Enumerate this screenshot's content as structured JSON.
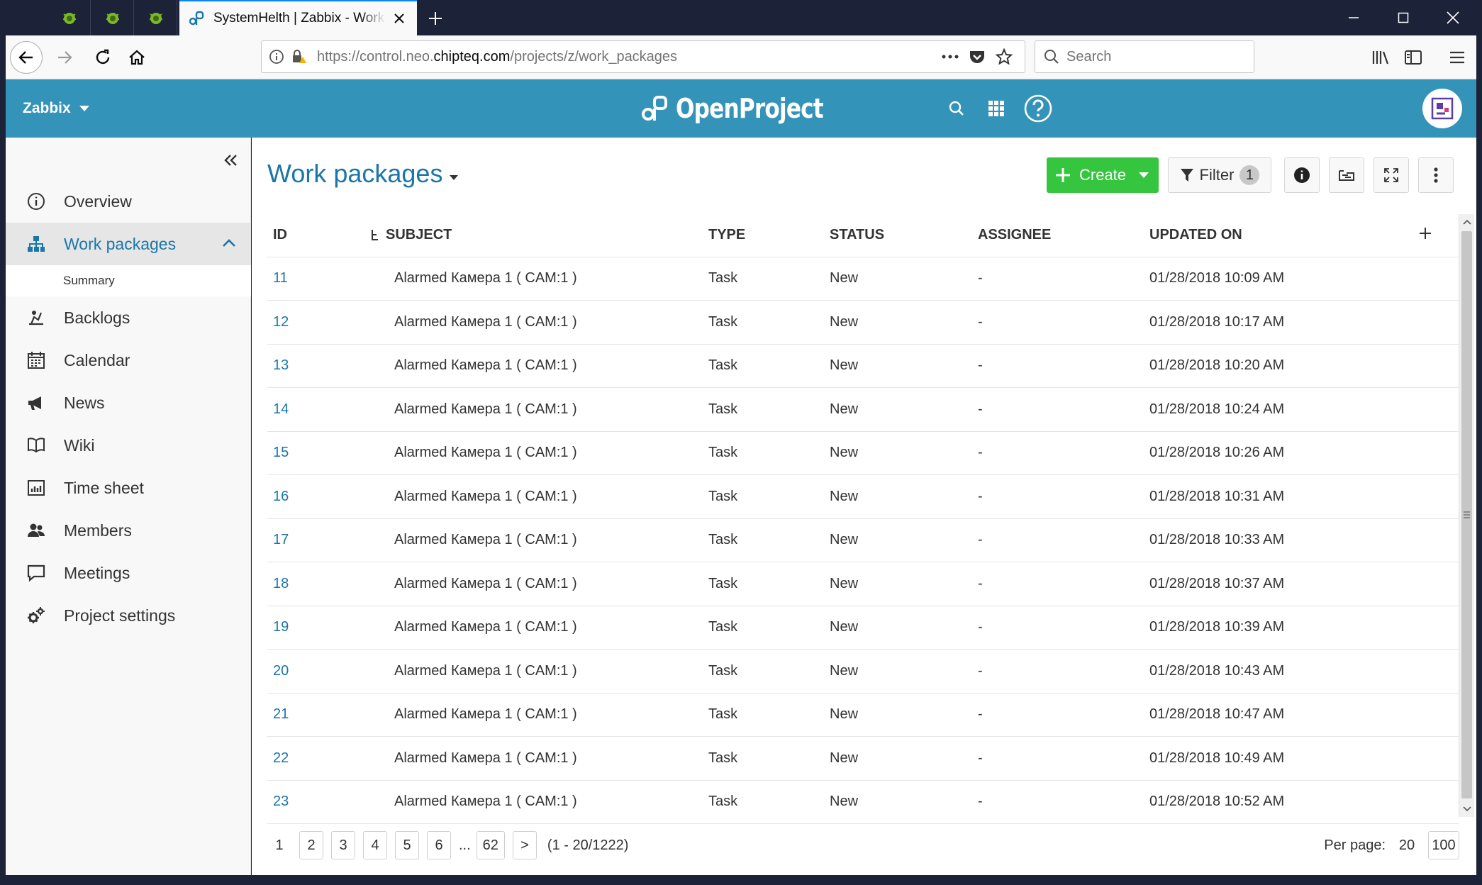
{
  "browser": {
    "tab_title": "SystemHelth | Zabbix - Work Packages",
    "url_prefix": "https://control.neo.",
    "url_host": "chipteq.com",
    "url_path": "/projects/z/work_packages",
    "search_placeholder": "Search"
  },
  "header": {
    "project_name": "Zabbix",
    "logo_text": "OpenProject"
  },
  "sidebar": {
    "items": [
      {
        "label": "Overview"
      },
      {
        "label": "Work packages"
      },
      {
        "label": "Backlogs"
      },
      {
        "label": "Calendar"
      },
      {
        "label": "News"
      },
      {
        "label": "Wiki"
      },
      {
        "label": "Time sheet"
      },
      {
        "label": "Members"
      },
      {
        "label": "Meetings"
      },
      {
        "label": "Project settings"
      }
    ],
    "submenu": {
      "label": "Summary"
    }
  },
  "main": {
    "title": "Work packages",
    "create_label": "Create",
    "filter_label": "Filter",
    "filter_count": "1",
    "columns": [
      "ID",
      "SUBJECT",
      "TYPE",
      "STATUS",
      "ASSIGNEE",
      "UPDATED ON"
    ],
    "rows": [
      {
        "id": "11",
        "subject": "Alarmed Камера 1 ( CAM:1 )",
        "type": "Task",
        "status": "New",
        "assignee": "-",
        "updated": "01/28/2018 10:09 AM"
      },
      {
        "id": "12",
        "subject": "Alarmed Камера 1 ( CAM:1 )",
        "type": "Task",
        "status": "New",
        "assignee": "-",
        "updated": "01/28/2018 10:17 AM"
      },
      {
        "id": "13",
        "subject": "Alarmed Камера 1 ( CAM:1 )",
        "type": "Task",
        "status": "New",
        "assignee": "-",
        "updated": "01/28/2018 10:20 AM"
      },
      {
        "id": "14",
        "subject": "Alarmed Камера 1 ( CAM:1 )",
        "type": "Task",
        "status": "New",
        "assignee": "-",
        "updated": "01/28/2018 10:24 AM"
      },
      {
        "id": "15",
        "subject": "Alarmed Камера 1 ( CAM:1 )",
        "type": "Task",
        "status": "New",
        "assignee": "-",
        "updated": "01/28/2018 10:26 AM"
      },
      {
        "id": "16",
        "subject": "Alarmed Камера 1 ( CAM:1 )",
        "type": "Task",
        "status": "New",
        "assignee": "-",
        "updated": "01/28/2018 10:31 AM"
      },
      {
        "id": "17",
        "subject": "Alarmed Камера 1 ( CAM:1 )",
        "type": "Task",
        "status": "New",
        "assignee": "-",
        "updated": "01/28/2018 10:33 AM"
      },
      {
        "id": "18",
        "subject": "Alarmed Камера 1 ( CAM:1 )",
        "type": "Task",
        "status": "New",
        "assignee": "-",
        "updated": "01/28/2018 10:37 AM"
      },
      {
        "id": "19",
        "subject": "Alarmed Камера 1 ( CAM:1 )",
        "type": "Task",
        "status": "New",
        "assignee": "-",
        "updated": "01/28/2018 10:39 AM"
      },
      {
        "id": "20",
        "subject": "Alarmed Камера 1 ( CAM:1 )",
        "type": "Task",
        "status": "New",
        "assignee": "-",
        "updated": "01/28/2018 10:43 AM"
      },
      {
        "id": "21",
        "subject": "Alarmed Камера 1 ( CAM:1 )",
        "type": "Task",
        "status": "New",
        "assignee": "-",
        "updated": "01/28/2018 10:47 AM"
      },
      {
        "id": "22",
        "subject": "Alarmed Камера 1 ( CAM:1 )",
        "type": "Task",
        "status": "New",
        "assignee": "-",
        "updated": "01/28/2018 10:49 AM"
      },
      {
        "id": "23",
        "subject": "Alarmed Камера 1 ( CAM:1 )",
        "type": "Task",
        "status": "New",
        "assignee": "-",
        "updated": "01/28/2018 10:52 AM"
      }
    ]
  },
  "pagination": {
    "current": "1",
    "pages": [
      "2",
      "3",
      "4",
      "5",
      "6"
    ],
    "ellipsis": "...",
    "last": "62",
    "next": ">",
    "range": "(1 - 20/1222)",
    "per_page_label": "Per page:",
    "per_page_options": [
      "20",
      "100"
    ]
  },
  "colors": {
    "header_bg": "#3493b8",
    "accent_link": "#1b76a8",
    "create_green": "#35c53f"
  }
}
